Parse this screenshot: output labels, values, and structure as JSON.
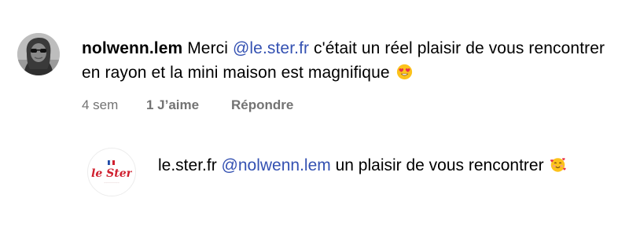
{
  "comment": {
    "username": "nolwenn.lem",
    "text_before": "Merci",
    "mention": "@le.ster.fr",
    "text_after": "c'était un réel plaisir de vous rencontrer en rayon et la mini maison est magnifique",
    "emoji": "heart-eyes-emoji",
    "time": "4 sem",
    "likes": "1 J’aime",
    "reply_label": "Répondre"
  },
  "reply": {
    "username": "le.ster.fr",
    "mention": "@nolwenn.lem",
    "text": "un plaisir de vous rencontrer",
    "emoji": "smiling-hearts-emoji",
    "logo_text": "le Ster"
  },
  "colors": {
    "mention": "#3451b2",
    "meta": "#737373",
    "logo_red": "#d0202f"
  }
}
